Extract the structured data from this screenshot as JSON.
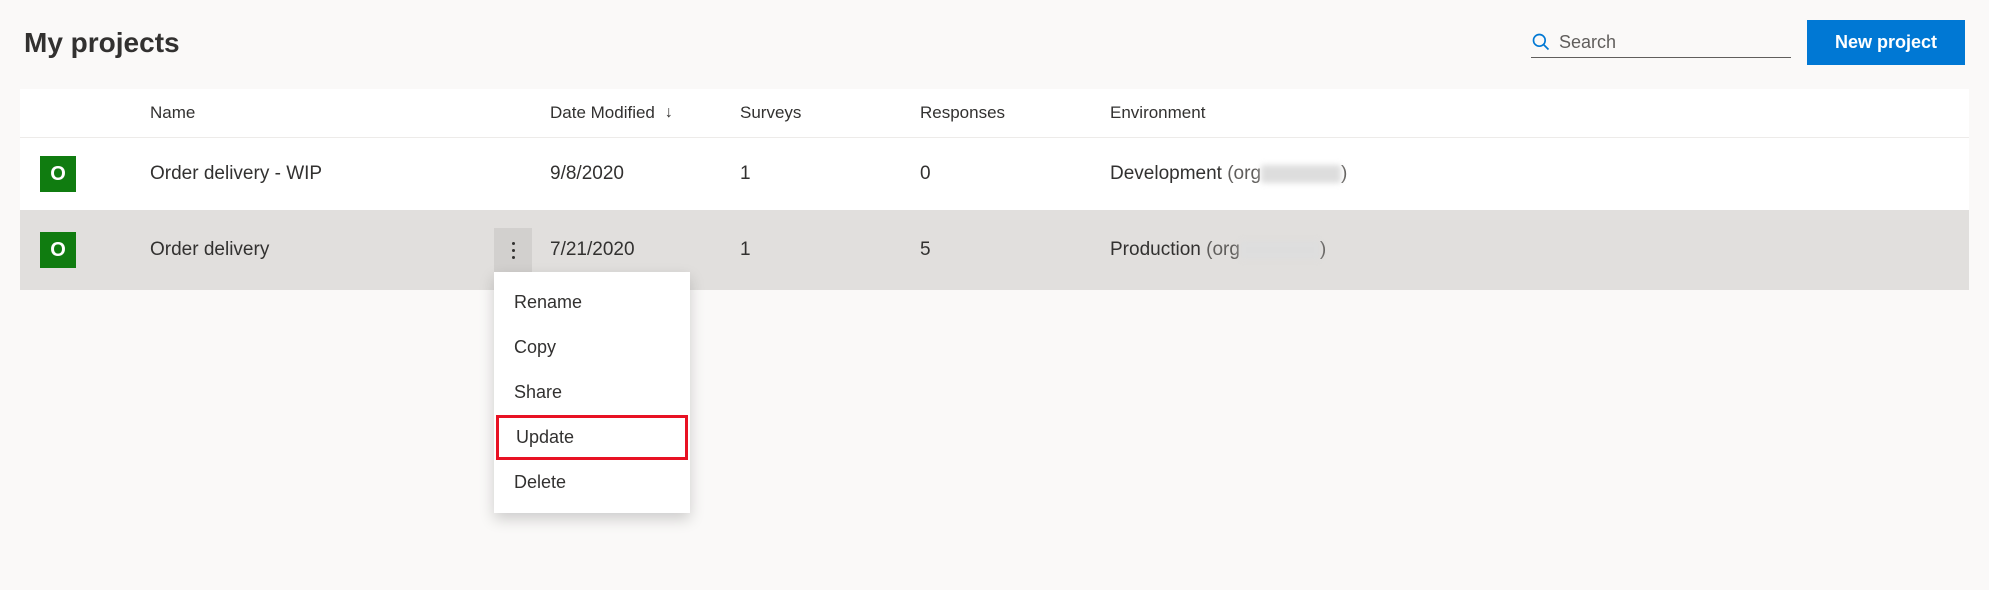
{
  "header": {
    "title": "My projects",
    "search_placeholder": "Search",
    "new_project_label": "New project"
  },
  "table": {
    "columns": {
      "name": "Name",
      "date_modified": "Date Modified",
      "surveys": "Surveys",
      "responses": "Responses",
      "environment": "Environment"
    },
    "rows": [
      {
        "icon_letter": "O",
        "name": "Order delivery - WIP",
        "date_modified": "9/8/2020",
        "surveys": "1",
        "responses": "0",
        "environment_name": "Development",
        "environment_org_prefix": "(org",
        "environment_org_suffix": ")",
        "selected": false
      },
      {
        "icon_letter": "O",
        "name": "Order delivery",
        "date_modified": "7/21/2020",
        "surveys": "1",
        "responses": "5",
        "environment_name": "Production",
        "environment_org_prefix": " (org",
        "environment_org_suffix": ")",
        "selected": true
      }
    ]
  },
  "context_menu": {
    "items": [
      {
        "label": "Rename",
        "highlighted": false
      },
      {
        "label": "Copy",
        "highlighted": false
      },
      {
        "label": "Share",
        "highlighted": false
      },
      {
        "label": "Update",
        "highlighted": true
      },
      {
        "label": "Delete",
        "highlighted": false
      }
    ]
  }
}
